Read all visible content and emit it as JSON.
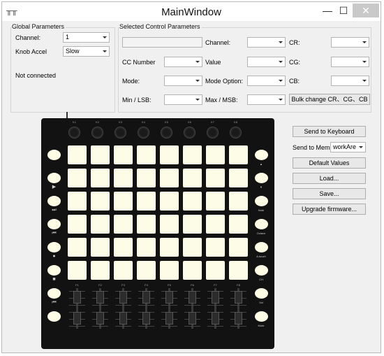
{
  "window": {
    "title": "MainWindow",
    "controls": {
      "minimize": "—",
      "maximize": "☐",
      "close": "✕"
    },
    "app_icon": "device-icon"
  },
  "global": {
    "title": "Global Parameters",
    "channel_label": "Channel:",
    "channel_value": "1",
    "knob_accel_label": "Knob Accel",
    "knob_accel_value": "Slow",
    "status": "Not connected"
  },
  "selected": {
    "title": "Selected Control Parameters",
    "name_value": "",
    "channel_label": "Channel:",
    "channel_value": "",
    "cr_label": "CR:",
    "cr_value": "",
    "cc_number_label": "CC Number",
    "cc_number_value": "",
    "value_label": "Value",
    "value_value": "",
    "cg_label": "CG:",
    "cg_value": "",
    "mode_label": "Mode:",
    "mode_value": "",
    "mode_option_label": "Mode Option:",
    "mode_option_value": "",
    "cb_label": "CB:",
    "cb_value": "",
    "min_lsb_label": "Min / LSB:",
    "min_lsb_value": "",
    "max_msb_label": "Max / MSB:",
    "max_msb_value": "",
    "bulk_button": "Bulk change CR、CG、CB"
  },
  "actions": {
    "send_keyboard": "Send to Keyboard",
    "send_mem_label": "Send to Mem",
    "send_mem_value": "workAre",
    "default_values": "Default Values",
    "load": "Load...",
    "save": "Save...",
    "upgrade": "Upgrade firmware..."
  },
  "device": {
    "knob_labels": [
      "K1",
      "K2",
      "K3",
      "K4",
      "K5",
      "K6",
      "K7",
      "K8"
    ],
    "fader_labels": [
      "F1",
      "F2",
      "F3",
      "F4",
      "F5",
      "F6",
      "F7",
      "F8"
    ],
    "left_icons": [
      "",
      "▶",
      "⏭",
      "⏮",
      "●",
      "■",
      "⏮",
      ""
    ],
    "right_labels": [
      "▲",
      "▼",
      "Note",
      "Octave",
      "A.touch",
      "CH",
      "Vol",
      "Mute"
    ],
    "pad_rows": 6,
    "pad_cols": 8,
    "colors": {
      "pad": "#fdfce6",
      "body": "#121212"
    }
  }
}
